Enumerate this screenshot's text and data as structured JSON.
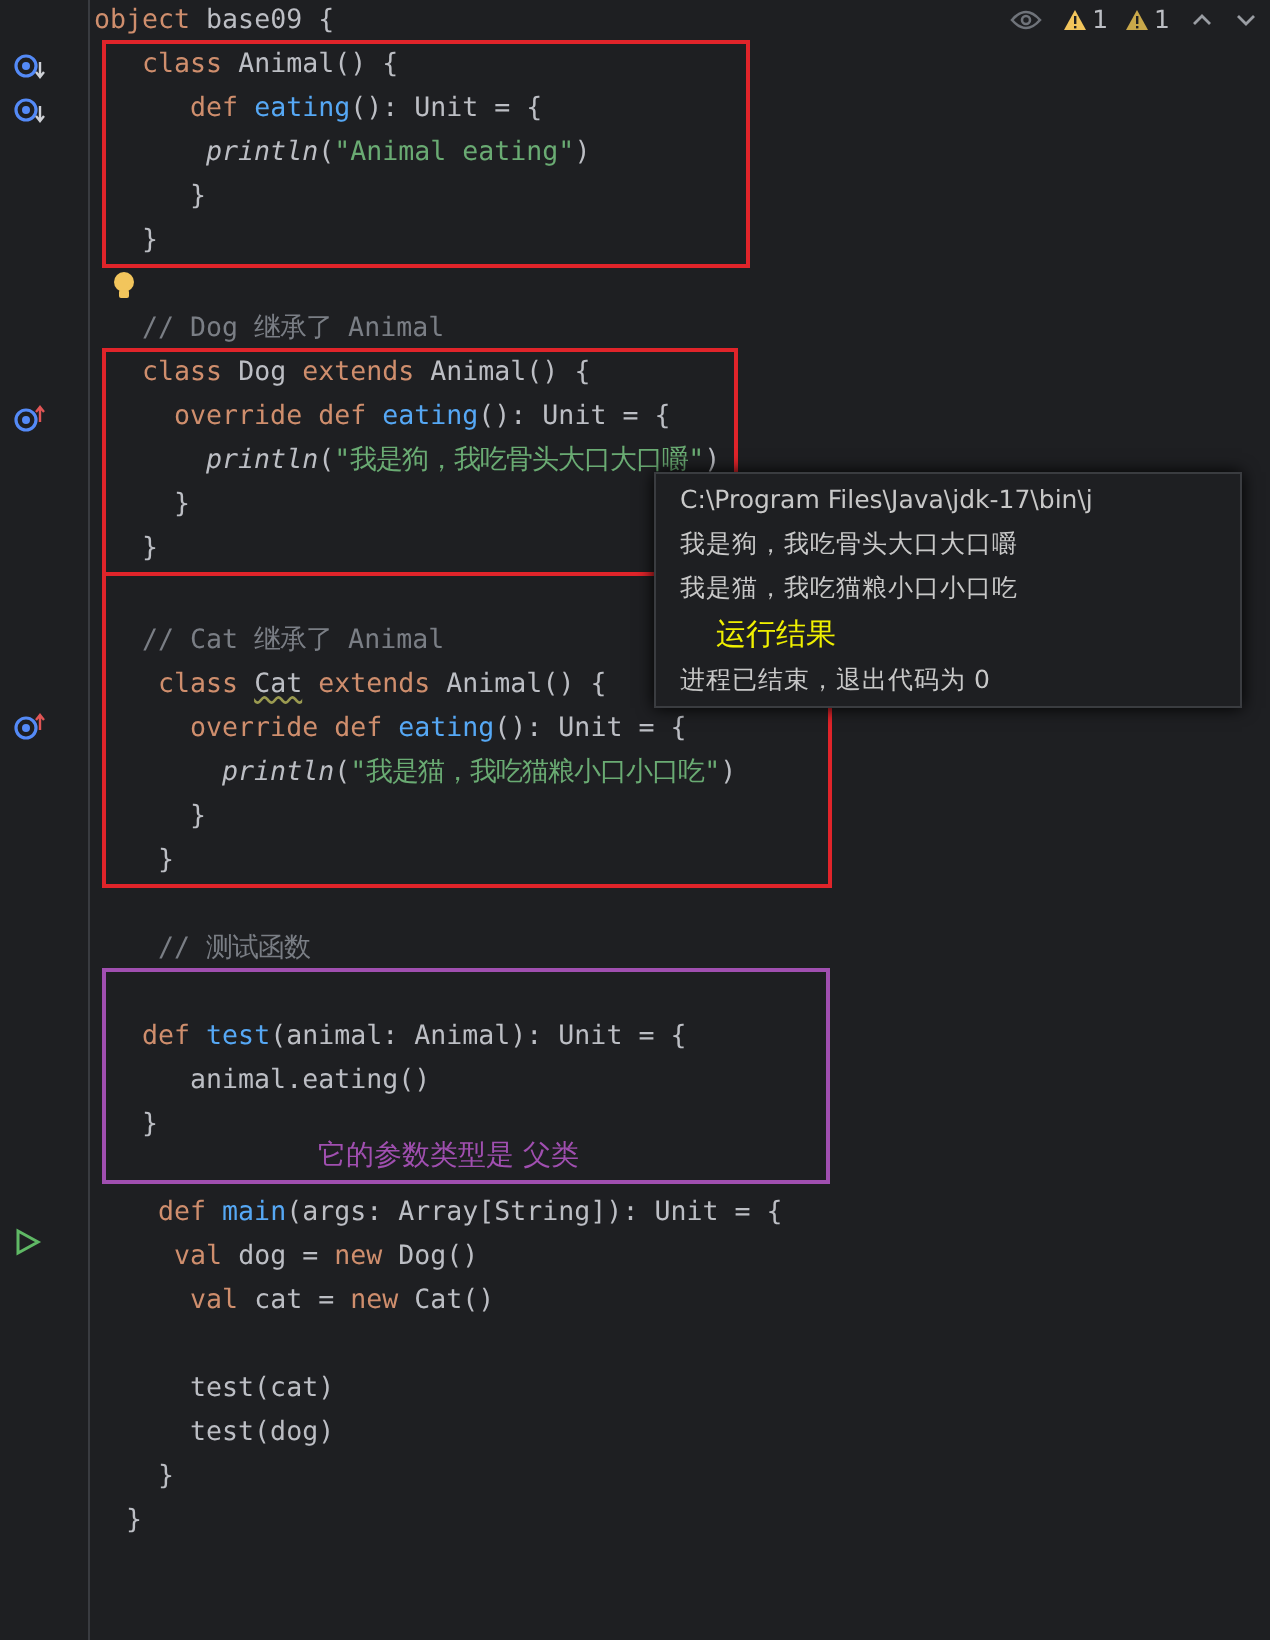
{
  "toolbar": {
    "inspections": [
      {
        "kind": "warning",
        "count": "1"
      },
      {
        "kind": "weak_warning",
        "count": "1"
      }
    ]
  },
  "code": [
    {
      "kind": "line",
      "tokens": [
        {
          "kind": "keyword",
          "text": "object "
        },
        {
          "kind": "plain",
          "text": "base09 {"
        }
      ]
    },
    {
      "kind": "frame",
      "color": "#e0242a",
      "lines": [
        {
          "kind": "line",
          "marker": {
            "kind": "implemented"
          },
          "tokens": [
            {
              "kind": "keyword",
              "text": "   class "
            },
            {
              "kind": "plain",
              "text": "Animal() {"
            }
          ]
        },
        {
          "kind": "line",
          "marker": {
            "kind": "implemented"
          },
          "tokens": [
            {
              "kind": "keyword",
              "text": "      def "
            },
            {
              "kind": "function",
              "text": "eating"
            },
            {
              "kind": "plain",
              "text": "(): Unit = {"
            }
          ]
        },
        {
          "kind": "line",
          "tokens": [
            {
              "kind": "call",
              "text": "       println"
            },
            {
              "kind": "plain",
              "text": "("
            },
            {
              "kind": "string",
              "text": "\"Animal eating\""
            },
            {
              "kind": "plain",
              "text": ")"
            }
          ]
        },
        {
          "kind": "line",
          "tokens": [
            {
              "kind": "plain",
              "text": "      }"
            }
          ]
        },
        {
          "kind": "line",
          "tokens": [
            {
              "kind": "plain",
              "text": "   }"
            }
          ]
        }
      ]
    },
    {
      "kind": "blank",
      "marker": {
        "kind": "bulb"
      }
    },
    {
      "kind": "line",
      "tokens": [
        {
          "kind": "comment",
          "text": "   // Dog 继承了 Animal"
        }
      ]
    },
    {
      "kind": "frame",
      "color": "#e0242a",
      "lines": [
        {
          "kind": "line",
          "tokens": [
            {
              "kind": "keyword",
              "text": "   class "
            },
            {
              "kind": "plain",
              "text": "Dog "
            },
            {
              "kind": "keyword",
              "text": "extends "
            },
            {
              "kind": "plain",
              "text": "Animal() {"
            }
          ]
        },
        {
          "kind": "line",
          "marker": {
            "kind": "overrides"
          },
          "tokens": [
            {
              "kind": "keyword",
              "text": "     override def "
            },
            {
              "kind": "function",
              "text": "eating"
            },
            {
              "kind": "plain",
              "text": "(): Unit = {"
            }
          ]
        },
        {
          "kind": "line",
          "tokens": [
            {
              "kind": "call",
              "text": "       println"
            },
            {
              "kind": "plain",
              "text": "("
            },
            {
              "kind": "string",
              "text": "\"我是狗，我吃骨头大口大口嚼\""
            },
            {
              "kind": "plain",
              "text": ")"
            }
          ]
        },
        {
          "kind": "line",
          "tokens": [
            {
              "kind": "plain",
              "text": "     }"
            }
          ]
        },
        {
          "kind": "line",
          "tokens": [
            {
              "kind": "plain",
              "text": "   }"
            }
          ]
        }
      ]
    },
    {
      "kind": "frame",
      "color": "#e0242a",
      "lines": [
        {
          "kind": "blank"
        },
        {
          "kind": "line",
          "tokens": [
            {
              "kind": "comment",
              "text": "   // Cat 继承了 Animal"
            }
          ]
        },
        {
          "kind": "line",
          "tokens": [
            {
              "kind": "keyword",
              "text": "    class "
            },
            {
              "kind": "warning",
              "text": "Cat"
            },
            {
              "kind": "keyword",
              "text": " extends "
            },
            {
              "kind": "plain",
              "text": "Animal() {"
            }
          ]
        },
        {
          "kind": "line",
          "marker": {
            "kind": "overrides"
          },
          "tokens": [
            {
              "kind": "keyword",
              "text": "      override def "
            },
            {
              "kind": "function",
              "text": "eating"
            },
            {
              "kind": "plain",
              "text": "(): Unit = {"
            }
          ]
        },
        {
          "kind": "line",
          "tokens": [
            {
              "kind": "call",
              "text": "        println"
            },
            {
              "kind": "plain",
              "text": "("
            },
            {
              "kind": "string",
              "text": "\"我是猫，我吃猫粮小口小口吃\""
            },
            {
              "kind": "plain",
              "text": ")"
            }
          ]
        },
        {
          "kind": "line",
          "tokens": [
            {
              "kind": "plain",
              "text": "      }"
            }
          ]
        },
        {
          "kind": "line",
          "tokens": [
            {
              "kind": "plain",
              "text": "    }"
            }
          ]
        }
      ]
    },
    {
      "kind": "blank"
    },
    {
      "kind": "line",
      "tokens": [
        {
          "kind": "comment",
          "text": "    // 测试函数"
        }
      ]
    },
    {
      "kind": "frame",
      "color": "#a04fb0",
      "label": "它的参数类型是 父类",
      "lines": [
        {
          "kind": "blank"
        },
        {
          "kind": "line",
          "tokens": [
            {
              "kind": "keyword",
              "text": "   def "
            },
            {
              "kind": "function",
              "text": "test"
            },
            {
              "kind": "plain",
              "text": "(animal: Animal): Unit = {"
            }
          ]
        },
        {
          "kind": "line",
          "tokens": [
            {
              "kind": "plain",
              "text": "      animal.eating()"
            }
          ]
        },
        {
          "kind": "line",
          "tokens": [
            {
              "kind": "plain",
              "text": "   }"
            }
          ]
        }
      ]
    },
    {
      "kind": "blank"
    },
    {
      "kind": "line",
      "marker": {
        "kind": "run"
      },
      "tokens": [
        {
          "kind": "keyword",
          "text": "    def "
        },
        {
          "kind": "function",
          "text": "main"
        },
        {
          "kind": "plain",
          "text": "(args: Array[String]): Unit = {"
        }
      ]
    },
    {
      "kind": "line",
      "tokens": [
        {
          "kind": "keyword",
          "text": "     val "
        },
        {
          "kind": "plain",
          "text": "dog = "
        },
        {
          "kind": "keyword",
          "text": "new "
        },
        {
          "kind": "plain",
          "text": "Dog()"
        }
      ]
    },
    {
      "kind": "line",
      "tokens": [
        {
          "kind": "keyword",
          "text": "      val "
        },
        {
          "kind": "plain",
          "text": "cat = "
        },
        {
          "kind": "keyword",
          "text": "new "
        },
        {
          "kind": "plain",
          "text": "Cat()"
        }
      ]
    },
    {
      "kind": "blank"
    },
    {
      "kind": "line",
      "tokens": [
        {
          "kind": "plain",
          "text": "      test(cat)"
        }
      ]
    },
    {
      "kind": "line",
      "tokens": [
        {
          "kind": "plain",
          "text": "      test(dog)"
        }
      ]
    },
    {
      "kind": "line",
      "tokens": [
        {
          "kind": "plain",
          "text": "    }"
        }
      ]
    },
    {
      "kind": "line",
      "tokens": [
        {
          "kind": "plain",
          "text": "  }"
        }
      ]
    }
  ],
  "output": {
    "lines": [
      "C:\\Program Files\\Java\\jdk-17\\bin\\j",
      "我是狗，我吃骨头大口大口嚼",
      "我是猫，我吃猫粮小口小口吃"
    ],
    "label": "运行结果",
    "footer": "进程已结束，退出代码为 0"
  }
}
